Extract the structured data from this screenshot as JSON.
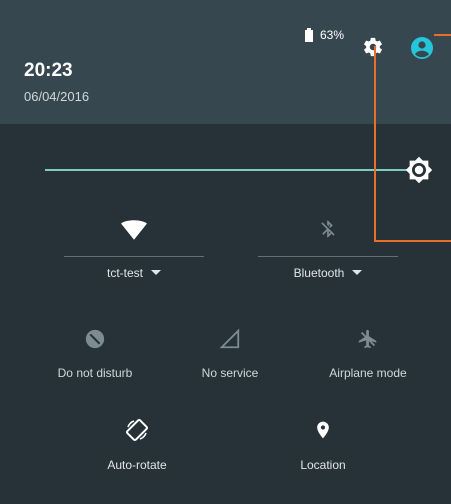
{
  "status_bar": {
    "battery_percent": "63%",
    "battery_icon": "battery-icon",
    "settings_icon": "gear-icon",
    "account_icon": "account-icon"
  },
  "header": {
    "time": "20:23",
    "date": "06/04/2016"
  },
  "brightness": {
    "icon": "brightness-icon"
  },
  "tiles": {
    "wifi": {
      "label": "tct-test",
      "icon": "wifi-icon",
      "enabled": true
    },
    "bluetooth": {
      "label": "Bluetooth",
      "icon": "bluetooth-off-icon",
      "enabled": false
    },
    "dnd": {
      "label": "Do not disturb",
      "icon": "do-not-disturb-icon",
      "enabled": false
    },
    "cell": {
      "label": "No service",
      "icon": "cell-signal-icon",
      "enabled": false
    },
    "airplane": {
      "label": "Airplane mode",
      "icon": "airplane-icon",
      "enabled": false
    },
    "autorotate": {
      "label": "Auto-rotate",
      "icon": "rotate-icon",
      "enabled": true
    },
    "location": {
      "label": "Location",
      "icon": "location-pin-icon",
      "enabled": true
    }
  },
  "colors": {
    "background": "#263238",
    "header": "#37474f",
    "accent": "#80cbc4",
    "account": "#26c6da",
    "annotation": "#e76f2a"
  }
}
